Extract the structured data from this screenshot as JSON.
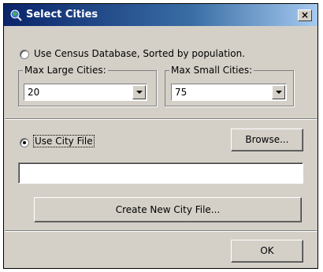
{
  "window": {
    "title": "Select Cities",
    "close_label": "×"
  },
  "census": {
    "label": "Use Census Database, Sorted by population.",
    "selected": false
  },
  "max_large": {
    "label": "Max Large Cities:",
    "value": "20"
  },
  "max_small": {
    "label": "Max Small Cities:",
    "value": "75"
  },
  "city_file": {
    "label": "Use City File",
    "selected": true,
    "path_value": ""
  },
  "buttons": {
    "browse": "Browse...",
    "create": "Create New City File...",
    "ok": "OK"
  },
  "colors": {
    "titlebar_start": "#0a246a",
    "titlebar_end": "#a6caf0",
    "dialog_bg": "#d4d0c8"
  },
  "icons": {
    "app": "globe-magnifier-icon",
    "close": "close-icon"
  }
}
